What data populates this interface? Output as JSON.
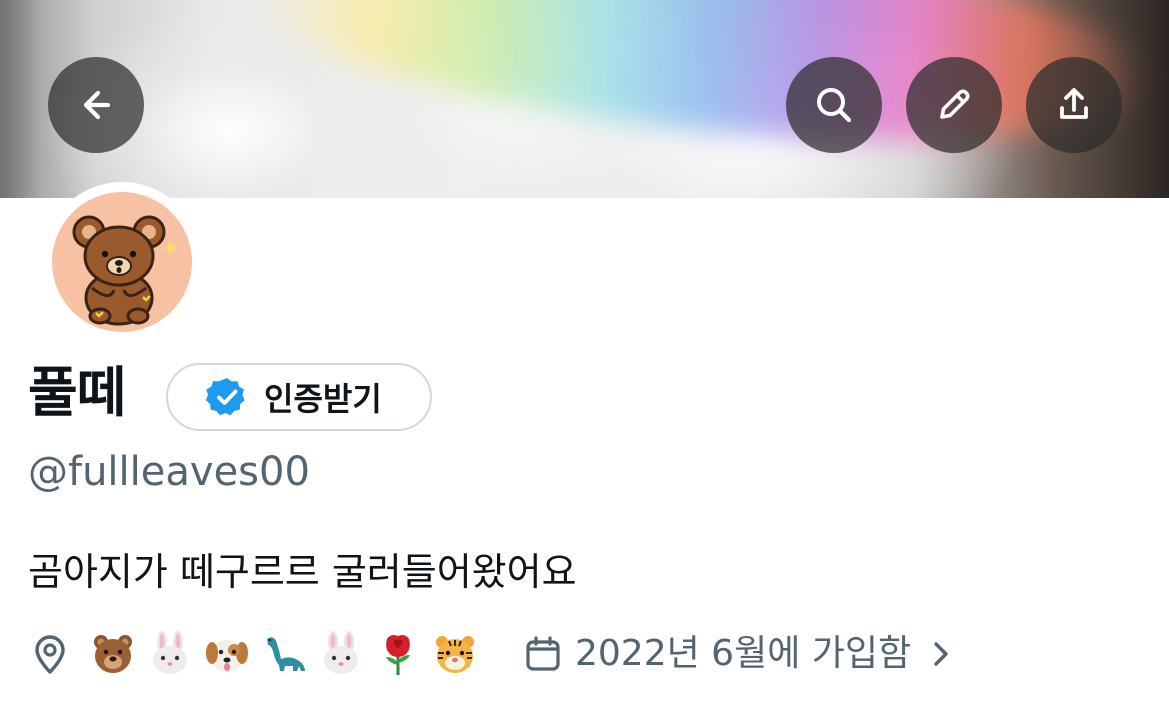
{
  "header": {
    "back_icon": "arrow-left-icon",
    "search_icon": "search-icon",
    "edit_icon": "pencil-icon",
    "share_icon": "share-upload-icon",
    "banner_image": "white-cat-rainbow-light-photo"
  },
  "profile": {
    "avatar": "brown-teddy-bear-avatar",
    "display_name": "풀떼",
    "verify_label": "인증받기",
    "verify_icon": "verified-badge-icon",
    "handle": "@fullleaves00",
    "bio": "곰아지가 떼구르르 굴러들어왔어요",
    "location_icon": "location-pin-icon",
    "location_emojis": [
      "bear-face",
      "rabbit-face",
      "dog-face",
      "sauropod",
      "rabbit-face",
      "rose",
      "tiger-face"
    ],
    "joined_icon": "calendar-icon",
    "joined_text": "2022년 6월에 가입함",
    "joined_chevron": "chevron-right-icon"
  },
  "colors": {
    "text_primary": "#0f1419",
    "text_secondary": "#536471",
    "verified_blue": "#1d9bf0",
    "button_border": "#cfd9de",
    "overlay_button": "#2d2d2d"
  }
}
